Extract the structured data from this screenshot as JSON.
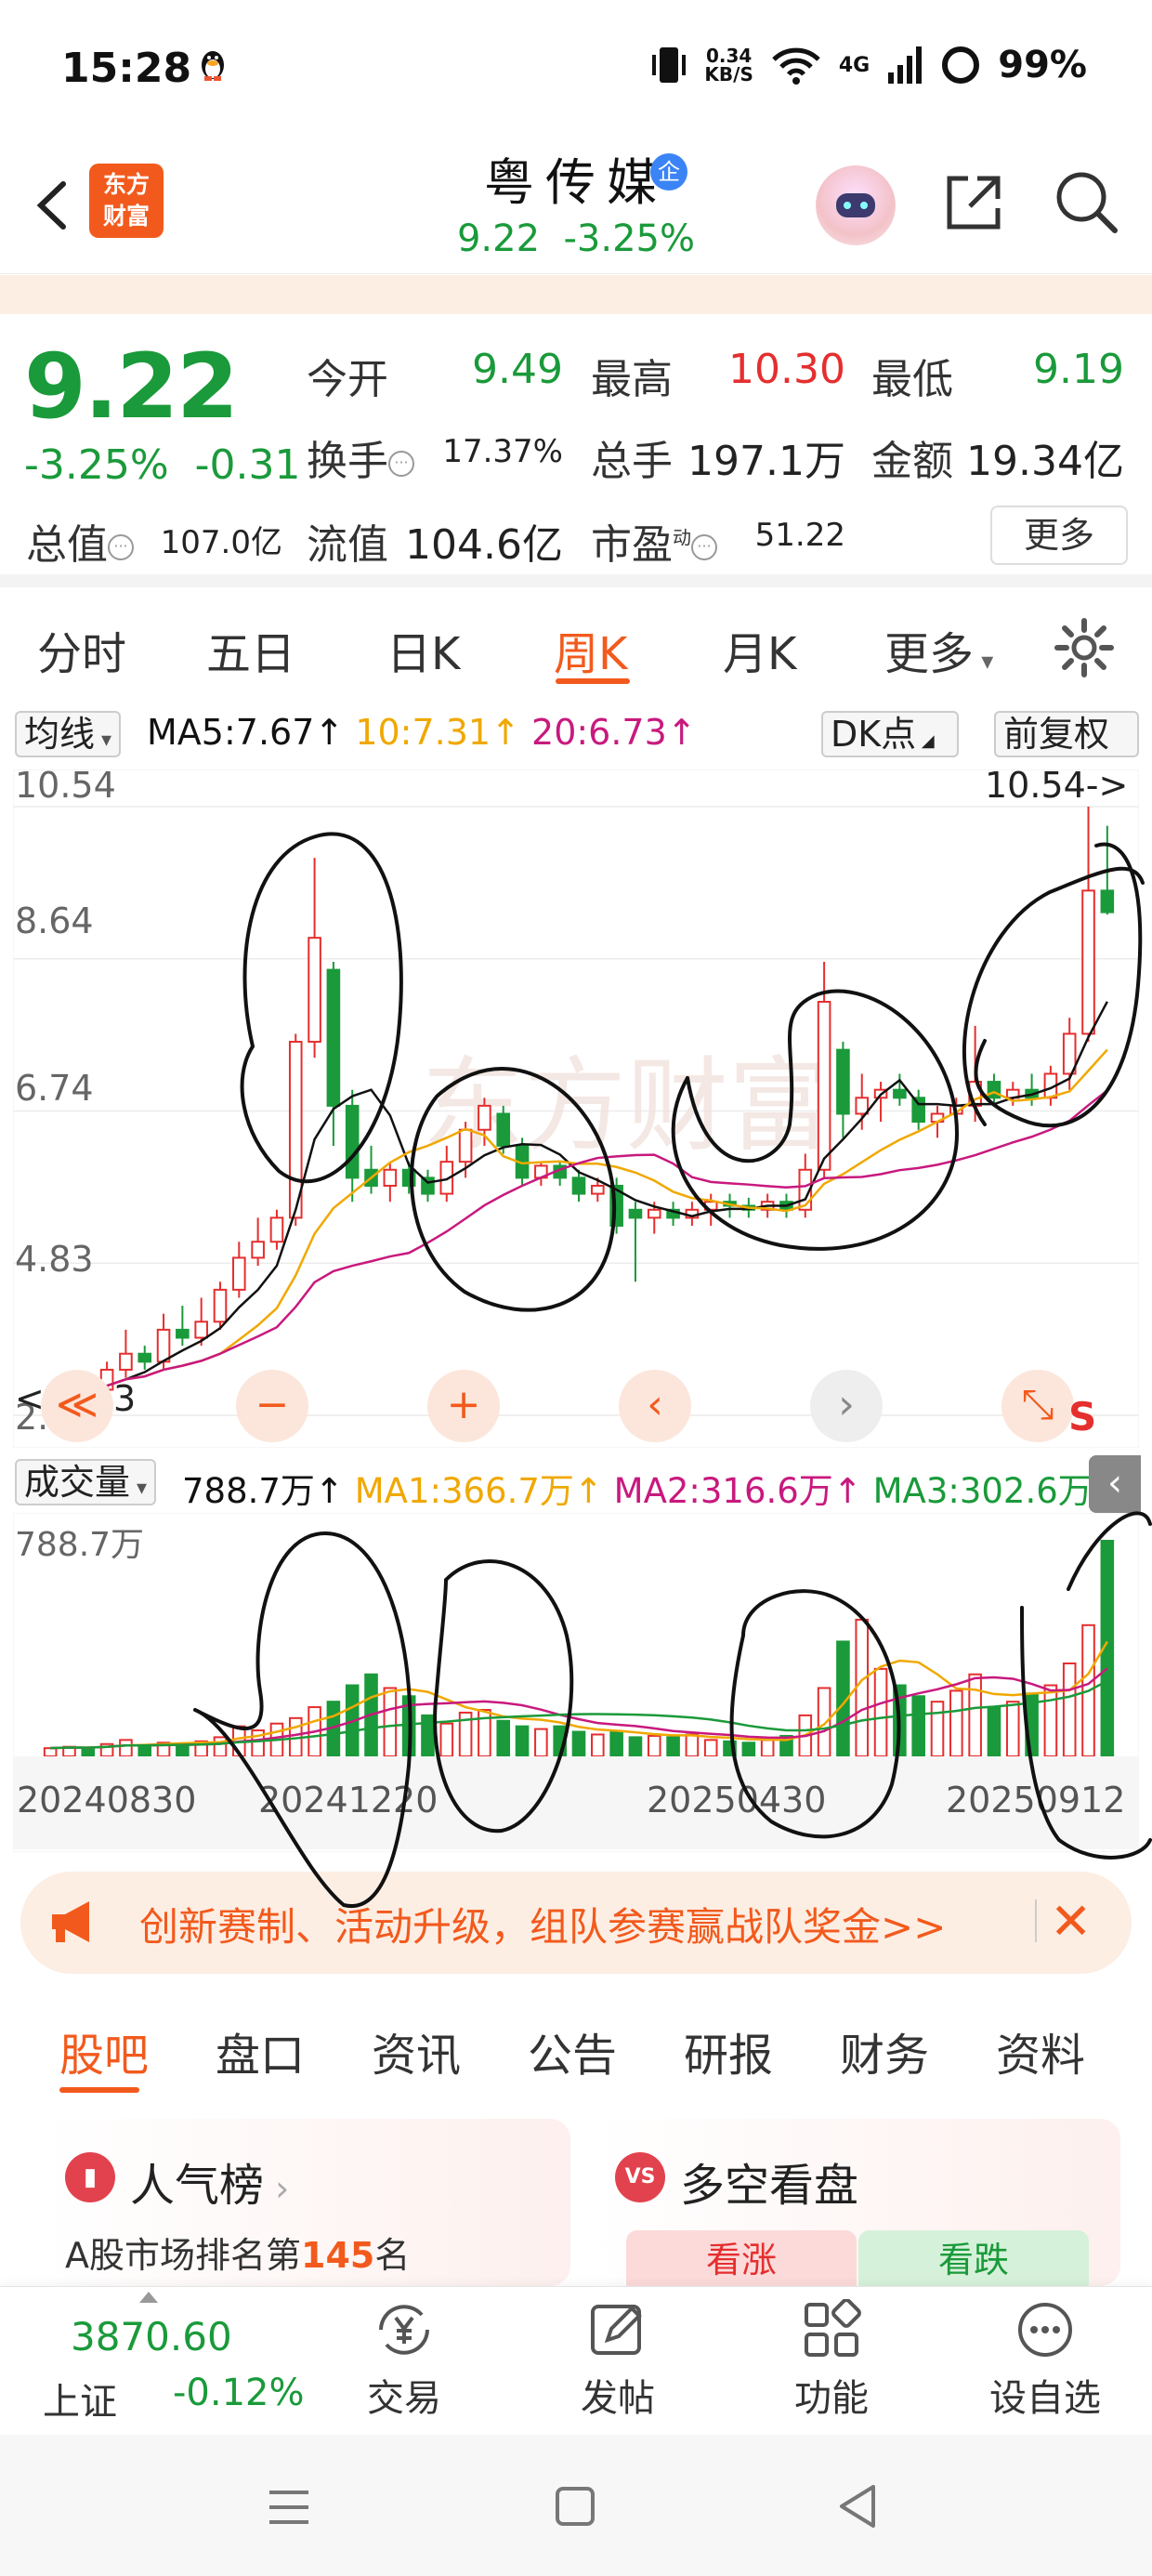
{
  "status_bar": {
    "time": "15:28",
    "net_speed": "0.34",
    "net_unit": "KB/S",
    "network": "4G",
    "battery": "99%"
  },
  "header": {
    "logo_line1": "东方",
    "logo_line2": "财富",
    "stock_name": "粤传媒",
    "badge": "企",
    "price": "9.22",
    "change_pct": "-3.25%"
  },
  "quote": {
    "price": "9.22",
    "change_pct": "-3.25%",
    "change_abs": "-0.31",
    "open_label": "今开",
    "open": "9.49",
    "high_label": "最高",
    "high": "10.30",
    "low_label": "最低",
    "low": "9.19",
    "turnover_label": "换手",
    "turnover": "17.37%",
    "volume_label": "总手",
    "volume": "197.1万",
    "amount_label": "金额",
    "amount": "19.34亿",
    "mcap_label": "总值",
    "mcap": "107.0亿",
    "float_label": "流值",
    "float": "104.6亿",
    "pe_label": "市盈",
    "pe_sup": "动",
    "pe": "51.22",
    "more_label": "更多"
  },
  "chart_tabs": [
    "分时",
    "五日",
    "日K",
    "周K",
    "月K",
    "更多"
  ],
  "active_tab": "周K",
  "indicator": {
    "selector": "均线",
    "ma5": "MA5:7.67↑",
    "ma10": "10:7.31↑",
    "ma20": "20:6.73↑",
    "dk_label": "DK点",
    "adjust_label": "前复权"
  },
  "axis": {
    "y1": "10.54",
    "y2": "8.64",
    "y3": "6.74",
    "y4": "4.83",
    "y5": "2.93",
    "max_marker": "10.54->",
    "min_marker": "<-2.93",
    "vol_max": "788.7万",
    "dates": [
      "20240830",
      "20241220",
      "20250430",
      "20250912"
    ]
  },
  "volume_panel": {
    "selector": "成交量",
    "current": "788.7万↑",
    "ma1": "MA1:366.7万↑",
    "ma2": "MA2:316.6万↑",
    "ma3": "MA3:302.6万↑"
  },
  "promo": {
    "text": "创新赛制、活动升级，组队参赛赢战队奖金>>"
  },
  "info_tabs": [
    "股吧",
    "盘口",
    "资讯",
    "公告",
    "研报",
    "财务",
    "资料"
  ],
  "cards": {
    "popularity_title": "人气榜",
    "popularity_sub_prefix": "A股市场排名第",
    "popularity_rank": "145",
    "popularity_sub_suffix": "名",
    "vs_badge": "VS",
    "sentiment_title": "多空看盘",
    "bull_label": "看涨",
    "bear_label": "看跌"
  },
  "bottom_bar": {
    "index_value": "3870.60",
    "index_name": "上证",
    "index_change": "-0.12%",
    "trade": "交易",
    "post": "发帖",
    "functions": "功能",
    "add_watch": "设自选"
  },
  "colors": {
    "accent": "#f25a1d",
    "up": "#e52e2e",
    "down": "#1a9a3a",
    "ma5": "#111111",
    "ma10": "#f0a800",
    "ma20": "#c8197e"
  },
  "chart_data": {
    "type": "candlestick",
    "title": "",
    "ylim": [
      2.93,
      10.54
    ],
    "x_ticks": [
      "20240830",
      "20241220",
      "20250430",
      "20250912"
    ],
    "candles": [
      [
        3.05,
        3.25,
        3.0,
        3.15
      ],
      [
        3.15,
        3.35,
        3.1,
        3.3
      ],
      [
        3.3,
        3.4,
        3.2,
        3.25
      ],
      [
        3.25,
        3.6,
        3.2,
        3.5
      ],
      [
        3.5,
        4.0,
        3.4,
        3.7
      ],
      [
        3.7,
        3.8,
        3.5,
        3.6
      ],
      [
        3.6,
        4.2,
        3.5,
        4.0
      ],
      [
        4.0,
        4.3,
        3.8,
        3.9
      ],
      [
        3.9,
        4.4,
        3.8,
        4.1
      ],
      [
        4.1,
        4.6,
        4.0,
        4.5
      ],
      [
        4.5,
        5.1,
        4.4,
        4.9
      ],
      [
        4.9,
        5.4,
        4.8,
        5.1
      ],
      [
        5.1,
        5.5,
        5.0,
        5.4
      ],
      [
        5.4,
        7.7,
        5.3,
        7.6
      ],
      [
        7.6,
        9.9,
        7.4,
        8.9
      ],
      [
        8.5,
        8.6,
        6.3,
        6.8
      ],
      [
        6.8,
        7.0,
        5.6,
        5.9
      ],
      [
        6.0,
        6.3,
        5.7,
        5.8
      ],
      [
        5.8,
        6.1,
        5.6,
        6.0
      ],
      [
        6.0,
        6.1,
        5.7,
        5.8
      ],
      [
        5.9,
        6.0,
        5.6,
        5.7
      ],
      [
        5.7,
        6.3,
        5.6,
        6.1
      ],
      [
        6.1,
        6.6,
        5.9,
        6.5
      ],
      [
        6.5,
        6.9,
        6.3,
        6.8
      ],
      [
        6.7,
        6.8,
        6.2,
        6.3
      ],
      [
        6.3,
        6.4,
        5.8,
        5.9
      ],
      [
        5.9,
        6.1,
        5.8,
        6.05
      ],
      [
        6.05,
        6.1,
        5.8,
        5.9
      ],
      [
        5.9,
        6.0,
        5.6,
        5.7
      ],
      [
        5.7,
        5.9,
        5.6,
        5.8
      ],
      [
        5.8,
        5.9,
        5.2,
        5.3
      ],
      [
        5.5,
        5.6,
        4.6,
        5.4
      ],
      [
        5.4,
        5.6,
        5.2,
        5.5
      ],
      [
        5.5,
        5.6,
        5.3,
        5.4
      ],
      [
        5.4,
        5.6,
        5.3,
        5.5
      ],
      [
        5.5,
        5.7,
        5.3,
        5.6
      ],
      [
        5.6,
        5.7,
        5.4,
        5.55
      ],
      [
        5.55,
        5.65,
        5.4,
        5.5
      ],
      [
        5.5,
        5.7,
        5.4,
        5.6
      ],
      [
        5.6,
        5.7,
        5.4,
        5.5
      ],
      [
        5.5,
        6.2,
        5.4,
        6.0
      ],
      [
        6.0,
        8.6,
        5.9,
        8.1
      ],
      [
        7.5,
        7.6,
        6.4,
        6.7
      ],
      [
        6.7,
        7.2,
        6.5,
        6.9
      ],
      [
        6.9,
        7.1,
        6.6,
        7.0
      ],
      [
        7.0,
        7.2,
        6.8,
        6.9
      ],
      [
        6.9,
        7.0,
        6.5,
        6.6
      ],
      [
        6.6,
        6.8,
        6.4,
        6.7
      ],
      [
        6.7,
        6.9,
        6.5,
        6.8
      ],
      [
        6.8,
        7.8,
        6.6,
        7.1
      ],
      [
        7.1,
        7.2,
        6.8,
        6.9
      ],
      [
        6.9,
        7.1,
        6.8,
        7.0
      ],
      [
        7.0,
        7.2,
        6.8,
        6.9
      ],
      [
        6.9,
        7.3,
        6.8,
        7.2
      ],
      [
        7.2,
        7.9,
        7.0,
        7.7
      ],
      [
        7.7,
        10.54,
        7.6,
        9.49
      ],
      [
        9.49,
        10.3,
        9.19,
        9.22
      ]
    ],
    "volume": [
      30,
      35,
      30,
      45,
      60,
      40,
      50,
      45,
      55,
      70,
      110,
      95,
      120,
      140,
      180,
      200,
      260,
      300,
      250,
      220,
      150,
      120,
      160,
      170,
      130,
      110,
      100,
      110,
      90,
      80,
      90,
      70,
      75,
      70,
      80,
      60,
      55,
      50,
      60,
      75,
      150,
      250,
      420,
      500,
      320,
      260,
      220,
      200,
      240,
      300,
      180,
      200,
      230,
      260,
      340,
      480,
      788.7
    ],
    "series": [
      {
        "name": "MA5",
        "value": "7.67"
      },
      {
        "name": "MA10",
        "value": "7.31"
      },
      {
        "name": "MA20",
        "value": "6.73"
      }
    ]
  }
}
